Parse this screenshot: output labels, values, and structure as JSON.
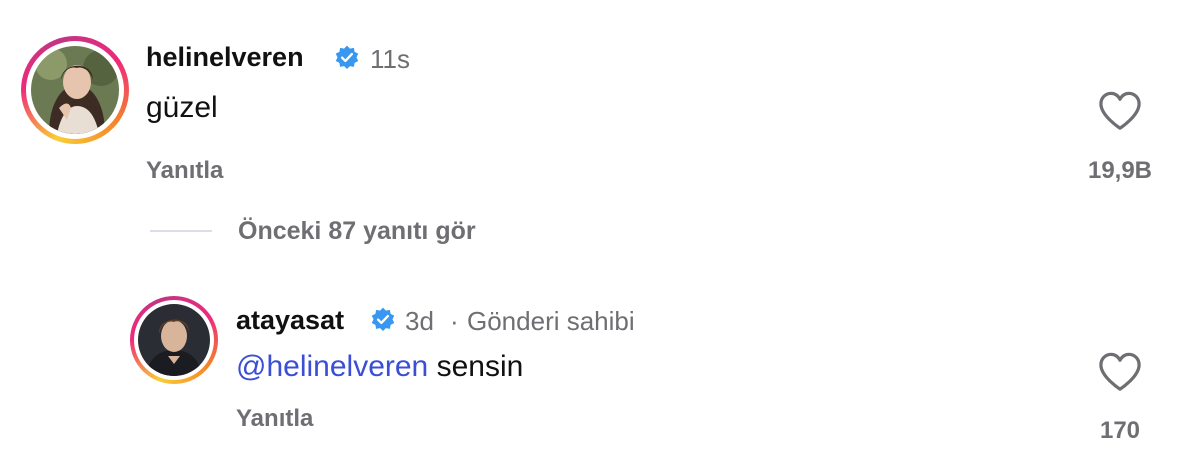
{
  "comments": [
    {
      "username": "helinelveren",
      "verified": true,
      "timestamp": "11s",
      "text": "güzel",
      "reply_label": "Yanıtla",
      "like_count": "19,9B"
    }
  ],
  "view_replies": {
    "label": "Önceki 87 yanıtı gör"
  },
  "replies": [
    {
      "username": "atayasat",
      "verified": true,
      "timestamp": "3d",
      "separator": "·",
      "owner_label": "Gönderi sahibi",
      "mention": "@helinelveren",
      "text": "sensin",
      "reply_label": "Yanıtla",
      "like_count": "170"
    }
  ],
  "colors": {
    "verified_badge": "#3897f0",
    "mention": "#3b4ed6",
    "secondary_text": "#6e6e73"
  },
  "icons": {
    "verified": "verified-badge-icon",
    "like": "heart-outline-icon"
  }
}
